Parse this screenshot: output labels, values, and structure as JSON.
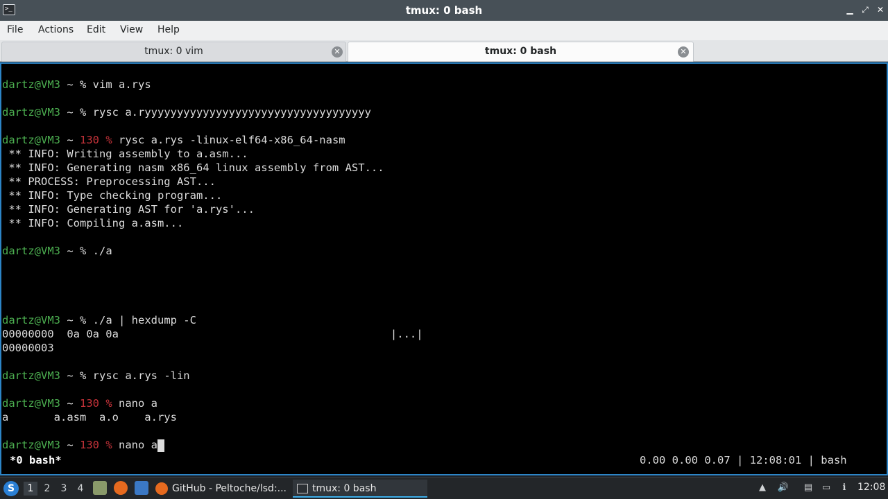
{
  "window": {
    "title": "tmux: 0 bash",
    "icon_text": ">_"
  },
  "menu": [
    "File",
    "Actions",
    "Edit",
    "View",
    "Help"
  ],
  "tabs": [
    {
      "label": "tmux: 0 vim",
      "active": false
    },
    {
      "label": "tmux: 0 bash",
      "active": true
    }
  ],
  "terminal": {
    "prompt": "dartz@VM3",
    "lines": [
      {
        "user": "dartz@VM3",
        "mid": " ~ ",
        "code": "",
        "rest": "% vim a.rys"
      },
      {
        "user": "dartz@VM3",
        "mid": " ~ ",
        "code": "",
        "rest": "% rysc a.ryyyyyyyyyyyyyyyyyyyyyyyyyyyyyyyyyyy"
      },
      {
        "user": "dartz@VM3",
        "mid": " ~ ",
        "code": "130 %",
        "rest": " rysc a.rys -linux-elf64-x86_64-nasm"
      },
      {
        "text": " ** INFO: Writing assembly to a.asm..."
      },
      {
        "text": " ** INFO: Generating nasm x86_64 linux assembly from AST..."
      },
      {
        "text": " ** PROCESS: Preprocessing AST..."
      },
      {
        "text": " ** INFO: Type checking program..."
      },
      {
        "text": " ** INFO: Generating AST for 'a.rys'..."
      },
      {
        "text": " ** INFO: Compiling a.asm..."
      },
      {
        "user": "dartz@VM3",
        "mid": " ~ ",
        "code": "",
        "rest": "% ./a"
      },
      {
        "user": "dartz@VM3",
        "mid": " ~ ",
        "code": "",
        "rest": "% ./a | hexdump -C"
      },
      {
        "text": "00000000  0a 0a 0a                                          |...|"
      },
      {
        "text": "00000003"
      },
      {
        "user": "dartz@VM3",
        "mid": " ~ ",
        "code": "",
        "rest": "% rysc a.rys -lin"
      },
      {
        "user": "dartz@VM3",
        "mid": " ~ ",
        "code": "130 %",
        "rest": " nano a"
      },
      {
        "text": "a       a.asm  a.o    a.rys"
      },
      {
        "user": "dartz@VM3",
        "mid": " ~ ",
        "code": "130 %",
        "rest": " nano a"
      }
    ],
    "status_left": "*0 bash*",
    "status_right": "0.00 0.00 0.07 | 12:08:01 | bash"
  },
  "taskbar": {
    "workspaces": [
      "1",
      "2",
      "3",
      "4"
    ],
    "active_workspace": "1",
    "tasks": [
      {
        "label": "GitHub - Peltoche/lsd:...",
        "icon": "firefox-icon"
      },
      {
        "label": "tmux: 0 bash",
        "icon": "terminal-icon"
      }
    ],
    "clock": "12:08"
  }
}
